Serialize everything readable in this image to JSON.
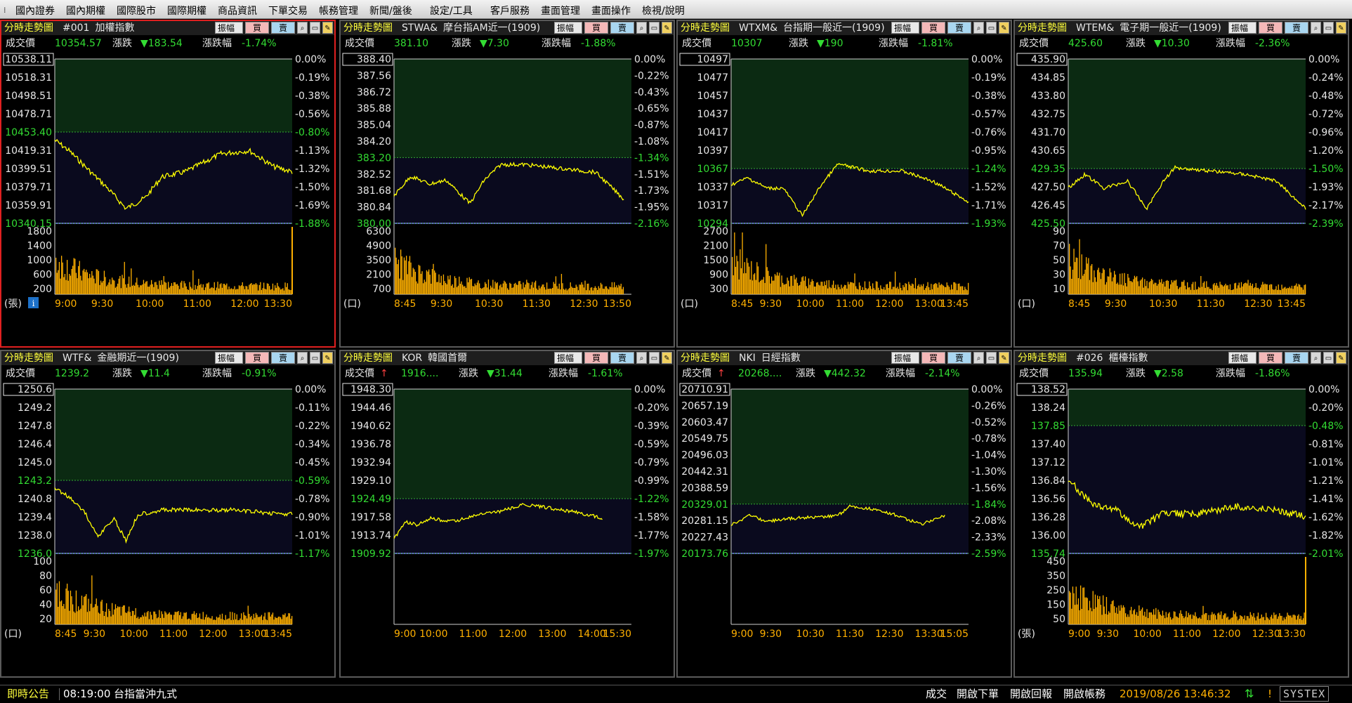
{
  "menu": [
    "國內證券",
    "國內期權",
    "國際股市",
    "國際期權",
    "商品資訊",
    "下單交易",
    "帳務管理",
    "新聞/盤後",
    "設定/工具",
    "客戶服務",
    "畫面管理",
    "畫面操作",
    "檢視/說明"
  ],
  "colors": {
    "up": "#ff4040",
    "down": "#33dd33",
    "line": "#ffff00",
    "volume": "#ffb000",
    "bar_purple": "#8080ff",
    "dotted": "#33aa33"
  },
  "panel_common": {
    "title": "分時走勢圖",
    "price_label": "成交價",
    "change_label": "漲跌",
    "pct_label": "漲跌幅",
    "btn_amplitude": "振幅",
    "btn_buy": "買",
    "btn_sell": "賣",
    "icons": [
      "search-icon",
      "print-icon",
      "settings-icon"
    ]
  },
  "panels": [
    {
      "code": "#001",
      "name": "加權指數",
      "price": "10354.57",
      "change": "▼183.54",
      "pct": "-1.74%",
      "arrow": "",
      "y_left": [
        "10538.11",
        "10518.31",
        "10498.51",
        "10478.71",
        "10453.40",
        "10419.31",
        "10399.51",
        "10379.71",
        "10359.91",
        "10340.15"
      ],
      "y_right": [
        "0.00%",
        "-0.19%",
        "-0.38%",
        "-0.56%",
        "-0.80%",
        "-1.13%",
        "-1.32%",
        "-1.50%",
        "-1.69%",
        "-1.88%"
      ],
      "hl_left": [
        0,
        4,
        9
      ],
      "hl_right": [
        0,
        4,
        9
      ],
      "vol": [
        "1800",
        "1400",
        "1000",
        "600",
        "200"
      ],
      "unit": "(張)",
      "info_icon": "i",
      "x": [
        "9:00",
        "9:30",
        "10:00",
        "11:00",
        "12:00",
        "13:30"
      ],
      "end": 1.0,
      "vol_end_spike": true,
      "series": {
        "start": 0.25,
        "pts": [
          [
            0,
            0.25
          ],
          [
            0.06,
            0.35
          ],
          [
            0.15,
            0.55
          ],
          [
            0.22,
            0.7
          ],
          [
            0.3,
            0.9
          ],
          [
            0.38,
            0.8
          ],
          [
            0.45,
            0.6
          ],
          [
            0.55,
            0.55
          ],
          [
            0.7,
            0.38
          ],
          [
            0.82,
            0.35
          ],
          [
            0.92,
            0.5
          ],
          [
            1.0,
            0.55
          ]
        ]
      }
    },
    {
      "code": "STWA&",
      "name": "摩台指AM近一(1909)",
      "price": "381.10",
      "change": "▼7.30",
      "pct": "-1.88%",
      "arrow": "",
      "y_left": [
        "388.40",
        "387.56",
        "386.72",
        "385.88",
        "385.04",
        "384.20",
        "383.20",
        "382.52",
        "381.68",
        "380.84",
        "380.00"
      ],
      "y_right": [
        "0.00%",
        "-0.22%",
        "-0.43%",
        "-0.65%",
        "-0.87%",
        "-1.08%",
        "-1.34%",
        "-1.51%",
        "-1.73%",
        "-1.95%",
        "-2.16%"
      ],
      "hl_left": [
        0,
        6,
        10
      ],
      "hl_right": [
        0,
        6,
        10
      ],
      "vol": [
        "6300",
        "4900",
        "3500",
        "2100",
        "700"
      ],
      "unit": "(口)",
      "x": [
        "8:45",
        "9:30",
        "10:30",
        "11:30",
        "12:30",
        "13:50"
      ],
      "end": 0.97,
      "series": {
        "pts": [
          [
            0,
            0.7
          ],
          [
            0.07,
            0.45
          ],
          [
            0.15,
            0.55
          ],
          [
            0.22,
            0.5
          ],
          [
            0.32,
            0.8
          ],
          [
            0.38,
            0.5
          ],
          [
            0.45,
            0.3
          ],
          [
            0.55,
            0.3
          ],
          [
            0.7,
            0.35
          ],
          [
            0.85,
            0.4
          ],
          [
            0.97,
            0.75
          ]
        ]
      }
    },
    {
      "code": "WTXM&",
      "name": "台指期一般近一(1909)",
      "price": "10307",
      "change": "▼190",
      "pct": "-1.81%",
      "arrow": "",
      "y_left": [
        "10497",
        "10477",
        "10457",
        "10437",
        "10417",
        "10397",
        "10367",
        "10337",
        "10317",
        "10294"
      ],
      "y_right": [
        "0.00%",
        "-0.19%",
        "-0.38%",
        "-0.57%",
        "-0.76%",
        "-0.95%",
        "-1.24%",
        "-1.52%",
        "-1.71%",
        "-1.93%"
      ],
      "hl_left": [
        0,
        6,
        9
      ],
      "hl_right": [
        0,
        6,
        9
      ],
      "vol": [
        "2700",
        "2100",
        "1500",
        "900",
        "300"
      ],
      "unit": "(口)",
      "x": [
        "8:45",
        "9:30",
        "10:00",
        "11:00",
        "12:00",
        "13:00",
        "13:45"
      ],
      "end": 1.0,
      "series": {
        "pts": [
          [
            0,
            0.5
          ],
          [
            0.07,
            0.4
          ],
          [
            0.15,
            0.55
          ],
          [
            0.22,
            0.55
          ],
          [
            0.3,
            0.95
          ],
          [
            0.38,
            0.5
          ],
          [
            0.45,
            0.2
          ],
          [
            0.58,
            0.3
          ],
          [
            0.72,
            0.3
          ],
          [
            0.85,
            0.45
          ],
          [
            1.0,
            0.75
          ]
        ]
      }
    },
    {
      "code": "WTEM&",
      "name": "電子期一般近一(1909)",
      "price": "425.60",
      "change": "▼10.30",
      "pct": "-2.36%",
      "arrow": "",
      "y_left": [
        "435.90",
        "434.85",
        "433.80",
        "432.75",
        "431.70",
        "430.65",
        "429.35",
        "427.50",
        "426.45",
        "425.50"
      ],
      "y_right": [
        "0.00%",
        "-0.24%",
        "-0.48%",
        "-0.72%",
        "-0.96%",
        "-1.20%",
        "-1.50%",
        "-1.93%",
        "-2.17%",
        "-2.39%"
      ],
      "hl_left": [
        0,
        6,
        9
      ],
      "hl_right": [
        0,
        6,
        9
      ],
      "vol": [
        "90",
        "70",
        "50",
        "30",
        "10"
      ],
      "unit": "(口)",
      "x": [
        "8:45",
        "9:30",
        "10:30",
        "11:30",
        "12:30",
        "13:45"
      ],
      "end": 1.0,
      "series": {
        "pts": [
          [
            0,
            0.55
          ],
          [
            0.07,
            0.35
          ],
          [
            0.15,
            0.55
          ],
          [
            0.25,
            0.45
          ],
          [
            0.33,
            0.85
          ],
          [
            0.4,
            0.45
          ],
          [
            0.45,
            0.25
          ],
          [
            0.6,
            0.3
          ],
          [
            0.75,
            0.35
          ],
          [
            0.88,
            0.45
          ],
          [
            1.0,
            0.85
          ]
        ]
      }
    },
    {
      "code": "WTF&",
      "name": "金融期近一(1909)",
      "price": "1239.2",
      "change": "▼11.4",
      "pct": "-0.91%",
      "arrow": "",
      "y_left": [
        "1250.6",
        "1249.2",
        "1247.8",
        "1246.4",
        "1245.0",
        "1243.2",
        "1240.8",
        "1239.4",
        "1238.0",
        "1236.0"
      ],
      "y_right": [
        "0.00%",
        "-0.11%",
        "-0.22%",
        "-0.34%",
        "-0.45%",
        "-0.59%",
        "-0.78%",
        "-0.90%",
        "-1.01%",
        "-1.17%"
      ],
      "hl_left": [
        0,
        5,
        9
      ],
      "hl_right": [
        0,
        5,
        9
      ],
      "vol": [
        "100",
        "80",
        "60",
        "40",
        "20"
      ],
      "unit": "(口)",
      "x": [
        "8:45",
        "9:30",
        "10:00",
        "11:00",
        "12:00",
        "13:00",
        "13:45"
      ],
      "end": 1.0,
      "series": {
        "pts": [
          [
            0,
            0.3
          ],
          [
            0.06,
            0.4
          ],
          [
            0.12,
            0.55
          ],
          [
            0.18,
            0.85
          ],
          [
            0.25,
            0.65
          ],
          [
            0.3,
            0.9
          ],
          [
            0.35,
            0.6
          ],
          [
            0.45,
            0.55
          ],
          [
            0.6,
            0.55
          ],
          [
            0.75,
            0.55
          ],
          [
            0.88,
            0.58
          ],
          [
            1.0,
            0.6
          ]
        ]
      }
    },
    {
      "code": "KOR",
      "name": "韓國首爾",
      "price": "1916....",
      "change": "▼31.44",
      "pct": "-1.61%",
      "arrow": "↑",
      "y_left": [
        "1948.30",
        "1944.46",
        "1940.62",
        "1936.78",
        "1932.94",
        "1929.10",
        "1924.49",
        "1917.58",
        "1913.74",
        "1909.92"
      ],
      "y_right": [
        "0.00%",
        "-0.20%",
        "-0.39%",
        "-0.59%",
        "-0.79%",
        "-0.99%",
        "-1.22%",
        "-1.58%",
        "-1.77%",
        "-1.97%"
      ],
      "hl_left": [
        0,
        6,
        9
      ],
      "hl_right": [
        0,
        6,
        9
      ],
      "vol": [],
      "unit": "",
      "x": [
        "9:00",
        "10:00",
        "11:00",
        "12:00",
        "13:00",
        "14:00",
        "15:30"
      ],
      "end": 0.88,
      "series": {
        "pts": [
          [
            0,
            0.85
          ],
          [
            0.05,
            0.6
          ],
          [
            0.1,
            0.65
          ],
          [
            0.15,
            0.55
          ],
          [
            0.25,
            0.6
          ],
          [
            0.35,
            0.5
          ],
          [
            0.45,
            0.45
          ],
          [
            0.55,
            0.35
          ],
          [
            0.65,
            0.4
          ],
          [
            0.75,
            0.45
          ],
          [
            0.88,
            0.55
          ]
        ]
      }
    },
    {
      "code": "NKI",
      "name": "日經指數",
      "price": "20268....",
      "change": "▼442.32",
      "pct": "-2.14%",
      "arrow": "↑",
      "y_left": [
        "20710.91",
        "20657.19",
        "20603.47",
        "20549.75",
        "20496.03",
        "20442.31",
        "20388.59",
        "20329.01",
        "20281.15",
        "20227.43",
        "20173.76"
      ],
      "y_right": [
        "0.00%",
        "-0.26%",
        "-0.52%",
        "-0.78%",
        "-1.04%",
        "-1.30%",
        "-1.56%",
        "-1.84%",
        "-2.08%",
        "-2.33%",
        "-2.59%"
      ],
      "hl_left": [
        0,
        7,
        10
      ],
      "hl_right": [
        0,
        7,
        10
      ],
      "vol": [],
      "unit": "",
      "x": [
        "9:00",
        "9:30",
        "10:30",
        "11:30",
        "12:30",
        "13:30",
        "15:05"
      ],
      "end": 0.9,
      "series": {
        "pts": [
          [
            0,
            0.6
          ],
          [
            0.08,
            0.45
          ],
          [
            0.15,
            0.55
          ],
          [
            0.25,
            0.5
          ],
          [
            0.35,
            0.48
          ],
          [
            0.45,
            0.45
          ],
          [
            0.5,
            0.3
          ],
          [
            0.6,
            0.35
          ],
          [
            0.7,
            0.45
          ],
          [
            0.8,
            0.6
          ],
          [
            0.9,
            0.45
          ]
        ]
      }
    },
    {
      "code": "#026",
      "name": "櫃檯指數",
      "price": "135.94",
      "change": "▼2.58",
      "pct": "-1.86%",
      "arrow": "",
      "y_left": [
        "138.52",
        "138.24",
        "137.85",
        "137.40",
        "137.12",
        "136.84",
        "136.56",
        "136.28",
        "136.00",
        "135.74"
      ],
      "y_right": [
        "0.00%",
        "-0.20%",
        "-0.48%",
        "-0.81%",
        "-1.01%",
        "-1.21%",
        "-1.41%",
        "-1.62%",
        "-1.82%",
        "-2.01%"
      ],
      "hl_left": [
        0,
        2,
        9
      ],
      "hl_right": [
        0,
        2,
        9
      ],
      "vol": [
        "450",
        "350",
        "250",
        "150",
        "50"
      ],
      "unit": "(張)",
      "x": [
        "9:00",
        "9:30",
        "10:00",
        "11:00",
        "12:00",
        "12:30",
        "13:30"
      ],
      "end": 1.0,
      "vol_end_spike": true,
      "series": {
        "pts": [
          [
            0,
            0.5
          ],
          [
            0.05,
            0.6
          ],
          [
            0.12,
            0.7
          ],
          [
            0.2,
            0.72
          ],
          [
            0.3,
            0.85
          ],
          [
            0.4,
            0.75
          ],
          [
            0.55,
            0.75
          ],
          [
            0.7,
            0.7
          ],
          [
            0.85,
            0.72
          ],
          [
            1.0,
            0.77
          ]
        ]
      }
    }
  ],
  "status": {
    "notice_label": "即時公告",
    "time": "08:19:00",
    "message": "台指當沖九式",
    "items": [
      "成交",
      "開啟下單",
      "開啟回報",
      "開啟帳務"
    ],
    "datetime": "2019/08/26 13:46:32",
    "brand": "SYSTEX"
  }
}
